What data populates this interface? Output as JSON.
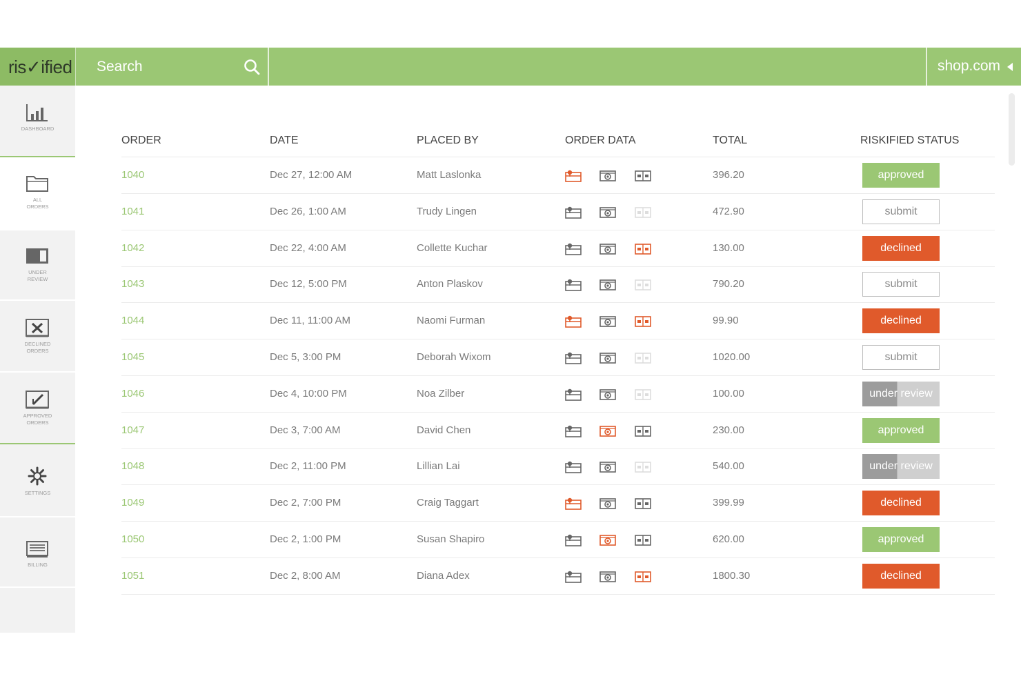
{
  "topbar": {
    "logo": "ris✓ified",
    "search_placeholder": "Search",
    "shop": "shop.com"
  },
  "sidebar": {
    "items": [
      {
        "id": "dashboard",
        "label": "DASHBOARD",
        "icon": "bar-chart-icon"
      },
      {
        "id": "all-orders",
        "label": "ALL\nORDERS",
        "icon": "folder-icon"
      },
      {
        "id": "under-review",
        "label": "UNDER\nREVIEW",
        "icon": "review-icon"
      },
      {
        "id": "declined-orders",
        "label": "DECLINED\nORDERS",
        "icon": "x-box-icon"
      },
      {
        "id": "approved-orders",
        "label": "APPROVED\nORDERS",
        "icon": "check-box-icon"
      },
      {
        "id": "settings",
        "label": "SETTINGS",
        "icon": "gear-icon"
      },
      {
        "id": "billing",
        "label": "BILLING",
        "icon": "billing-icon"
      }
    ]
  },
  "table": {
    "headers": [
      "ORDER",
      "DATE",
      "PLACED BY",
      "ORDER DATA",
      "TOTAL",
      "RISKIFIED STATUS"
    ],
    "rows": [
      {
        "order": "1040",
        "date": "Dec 27, 12:00 AM",
        "placed_by": "Matt Laslonka",
        "total": "396.20",
        "status": "approved",
        "status_type": "approved",
        "icons": [
          "red",
          "gray",
          "gray"
        ]
      },
      {
        "order": "1041",
        "date": "Dec 26, 1:00 AM",
        "placed_by": "Trudy Lingen",
        "total": "472.90",
        "status": "submit",
        "status_type": "submit",
        "icons": [
          "gray",
          "gray",
          "faint"
        ]
      },
      {
        "order": "1042",
        "date": "Dec 22, 4:00 AM",
        "placed_by": "Collette Kuchar",
        "total": "130.00",
        "status": "declined",
        "status_type": "declined",
        "icons": [
          "gray",
          "gray",
          "red"
        ]
      },
      {
        "order": "1043",
        "date": "Dec 12, 5:00 PM",
        "placed_by": "Anton Plaskov",
        "total": "790.20",
        "status": "submit",
        "status_type": "submit",
        "icons": [
          "gray",
          "gray",
          "faint"
        ]
      },
      {
        "order": "1044",
        "date": "Dec 11, 11:00 AM",
        "placed_by": "Naomi Furman",
        "total": "99.90",
        "status": "declined",
        "status_type": "declined",
        "icons": [
          "red",
          "gray",
          "red"
        ]
      },
      {
        "order": "1045",
        "date": "Dec 5,  3:00 PM",
        "placed_by": "Deborah Wixom",
        "total": "1020.00",
        "status": "submit",
        "status_type": "submit",
        "icons": [
          "gray",
          "gray",
          "faint"
        ]
      },
      {
        "order": "1046",
        "date": "Dec 4, 10:00 PM",
        "placed_by": "Noa Zilber",
        "total": "100.00",
        "status": "under review",
        "status_type": "review",
        "icons": [
          "gray",
          "gray",
          "faint"
        ]
      },
      {
        "order": "1047",
        "date": "Dec 3, 7:00 AM",
        "placed_by": "David Chen",
        "total": "230.00",
        "status": "approved",
        "status_type": "approved",
        "icons": [
          "gray",
          "red",
          "gray"
        ]
      },
      {
        "order": "1048",
        "date": "Dec 2, 11:00 PM",
        "placed_by": "Lillian Lai",
        "total": "540.00",
        "status": "under review",
        "status_type": "review",
        "icons": [
          "gray",
          "gray",
          "faint"
        ]
      },
      {
        "order": "1049",
        "date": "Dec 2, 7:00 PM",
        "placed_by": "Craig Taggart",
        "total": "399.99",
        "status": "declined",
        "status_type": "declined",
        "icons": [
          "red",
          "gray",
          "gray"
        ]
      },
      {
        "order": "1050",
        "date": "Dec 2, 1:00 PM",
        "placed_by": "Susan Shapiro",
        "total": "620.00",
        "status": "approved",
        "status_type": "approved",
        "icons": [
          "gray",
          "red",
          "gray"
        ]
      },
      {
        "order": "1051",
        "date": "Dec 2, 8:00 AM",
        "placed_by": "Diana Adex",
        "total": "1800.30",
        "status": "declined",
        "status_type": "declined",
        "icons": [
          "gray",
          "gray",
          "red"
        ]
      }
    ]
  },
  "colors": {
    "brand_green": "#9bc774",
    "declined_red": "#e05a2b",
    "icon_gray": "#666666",
    "icon_faint": "#dddddd"
  }
}
